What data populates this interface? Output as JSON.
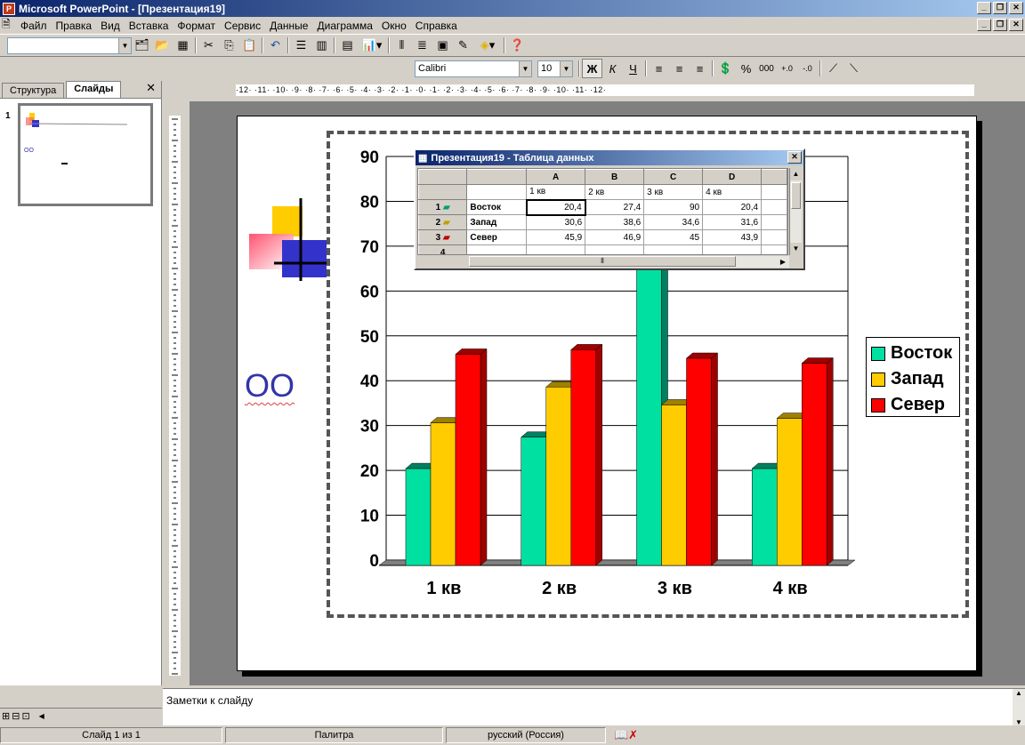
{
  "window": {
    "title": "Microsoft PowerPoint - [Презентация19]",
    "app_icon": "powerpoint-icon"
  },
  "menu": [
    "Файл",
    "Правка",
    "Вид",
    "Вставка",
    "Формат",
    "Сервис",
    "Данные",
    "Диаграмма",
    "Окно",
    "Справка"
  ],
  "formatting": {
    "font_name": "Calibri",
    "font_size": "10",
    "bold": "Ж",
    "italic": "К",
    "underline": "Ч",
    "percent": "%",
    "thousands": "000"
  },
  "left_panel": {
    "tabs": [
      "Структура",
      "Слайды"
    ],
    "active_tab": "Слайды",
    "close": "✕",
    "thumbnail_number": "1"
  },
  "ruler": {
    "h_text": "·12· ·11· ·10· ·9· ·8· ·7· ·6· ·5· ·4· ·3· ·2· ·1· ·0· ·1· ·2· ·3· ·4· ·5· ·6· ·7· ·8· ·9· ·10· ·11· ·12·"
  },
  "slide": {
    "text_oo": "OO"
  },
  "datasheet": {
    "title": "Презентация19 - Таблица данных",
    "col_headers": [
      "A",
      "B",
      "C",
      "D"
    ],
    "quarter_labels": [
      "1 кв",
      "2 кв",
      "3 кв",
      "4 кв"
    ],
    "rows": [
      {
        "num": "1",
        "name": "Восток",
        "values": [
          "20,4",
          "27,4",
          "90",
          "20,4"
        ]
      },
      {
        "num": "2",
        "name": "Запад",
        "values": [
          "30,6",
          "38,6",
          "34,6",
          "31,6"
        ]
      },
      {
        "num": "3",
        "name": "Север",
        "values": [
          "45,9",
          "46,9",
          "45",
          "43,9"
        ]
      },
      {
        "num": "4",
        "name": "",
        "values": [
          "",
          "",
          "",
          ""
        ]
      }
    ]
  },
  "chart_data": {
    "type": "bar",
    "categories": [
      "1 кв",
      "2 кв",
      "3 кв",
      "4 кв"
    ],
    "series": [
      {
        "name": "Восток",
        "values": [
          20.4,
          27.4,
          90,
          20.4
        ],
        "color": "#00e0a0",
        "side": "#008060"
      },
      {
        "name": "Запад",
        "values": [
          30.6,
          38.6,
          34.6,
          31.6
        ],
        "color": "#ffcc00",
        "side": "#a08000"
      },
      {
        "name": "Север",
        "values": [
          45.9,
          46.9,
          45,
          43.9
        ],
        "color": "#ff0000",
        "side": "#a00000"
      }
    ],
    "yticks": [
      "0",
      "10",
      "20",
      "30",
      "40",
      "50",
      "60",
      "70",
      "80",
      "90"
    ],
    "ylim": [
      0,
      90
    ],
    "grid": true,
    "legend": "right"
  },
  "notes": {
    "placeholder": "Заметки к слайду"
  },
  "status": {
    "slide": "Слайд 1 из 1",
    "design": "Палитра",
    "language": "русский (Россия)"
  }
}
